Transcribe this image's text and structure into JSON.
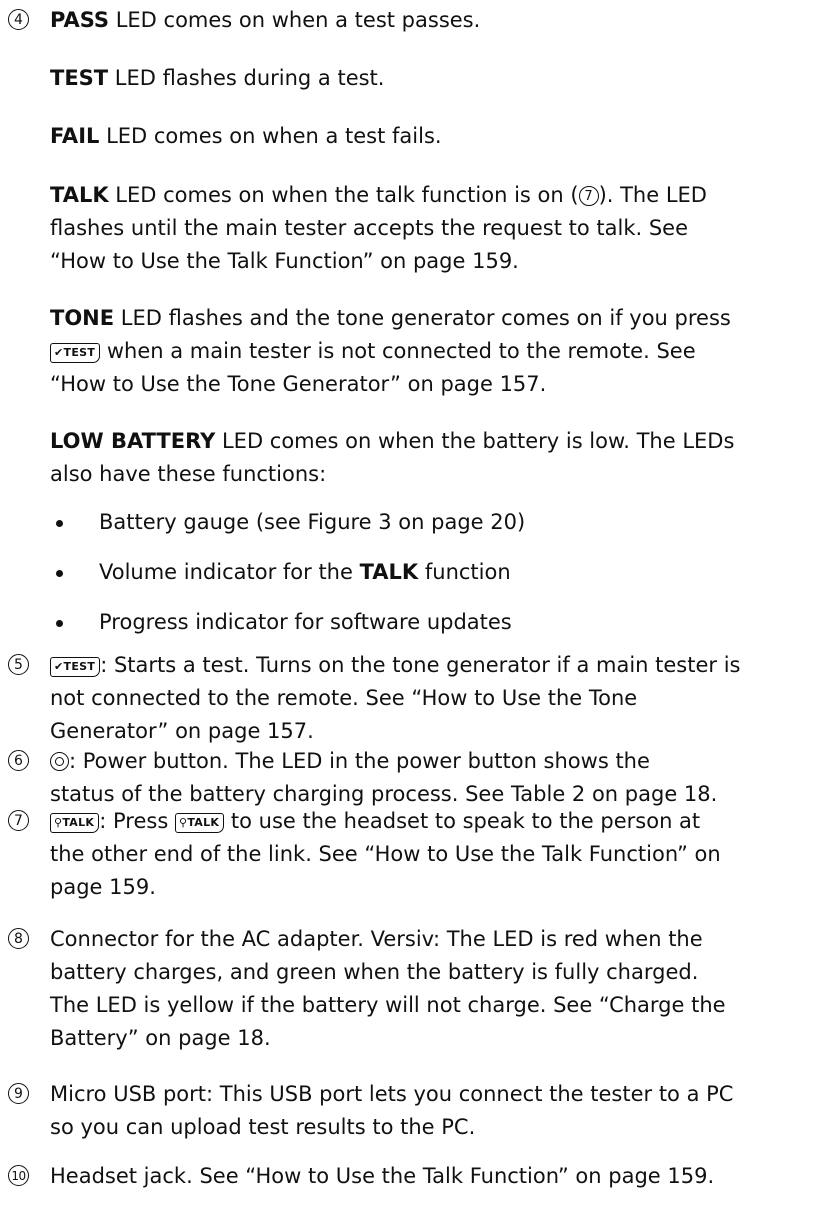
{
  "item4": {
    "number": "4",
    "pass": {
      "label": "PASS",
      "text": " LED comes on when a test passes."
    },
    "test": {
      "label": "TEST",
      "text": " LED flashes during a test."
    },
    "fail": {
      "label": "FAIL",
      "text": " LED comes on when a test fails."
    },
    "talk": {
      "label": "TALK",
      "text_a": " LED comes on when the talk function is on (",
      "ref": "7",
      "text_b": "). The LED",
      "line2": "flashes until the main tester accepts the request to talk. See",
      "line3": "“How to Use the Talk Function” on page 159."
    },
    "tone": {
      "label": "TONE",
      "line1": " LED flashes and the tone generator comes on if you press",
      "key": "TEST",
      "line2": " when a main tester is not connected to the remote. See",
      "line3": "“How to Use the Tone Generator” on page 157."
    },
    "battery": {
      "label": "LOW BATTERY",
      "line1": " LED comes on when the battery is low. The LEDs",
      "line2": "also have these functions:"
    },
    "bullets": [
      {
        "text": "Battery gauge (see Figure 3 on page 20)"
      },
      {
        "pre": "Volume indicator for the ",
        "bold": "TALK",
        "post": " function"
      },
      {
        "text": "Progress indicator for software updates"
      }
    ]
  },
  "item5": {
    "number": "5",
    "key": "TEST",
    "line1": ": Starts a test. Turns on the tone generator if a main tester is",
    "line2": "not connected to the remote. See “How to Use the Tone",
    "line3": "Generator” on page 157."
  },
  "item6": {
    "number": "6",
    "line1": ": Power button. The LED in the power button shows the",
    "line2": "status of the battery charging process. See Table 2 on page 18."
  },
  "item7": {
    "number": "7",
    "key": "TALK",
    "line1_a": ": Press ",
    "line1_b": " to use the headset to speak to the person at",
    "line2": "the other end of the link. See “How to Use the Talk Function” on",
    "line3": "page 159."
  },
  "item8": {
    "number": "8",
    "line1": "Connector for the AC adapter. Versiv: The LED is red when the",
    "line2": "battery charges, and green when the battery is fully charged.",
    "line3": "The LED is yellow if the battery will not charge. See “Charge the",
    "line4": "Battery” on page 18."
  },
  "item9": {
    "number": "9",
    "line1": "Micro USB port: This USB port lets you connect the tester to a PC",
    "line2": "so you can upload test results to the PC."
  },
  "item10": {
    "number": "10",
    "line1": "Headset jack. See “How to Use the Talk Function” on page 159."
  }
}
